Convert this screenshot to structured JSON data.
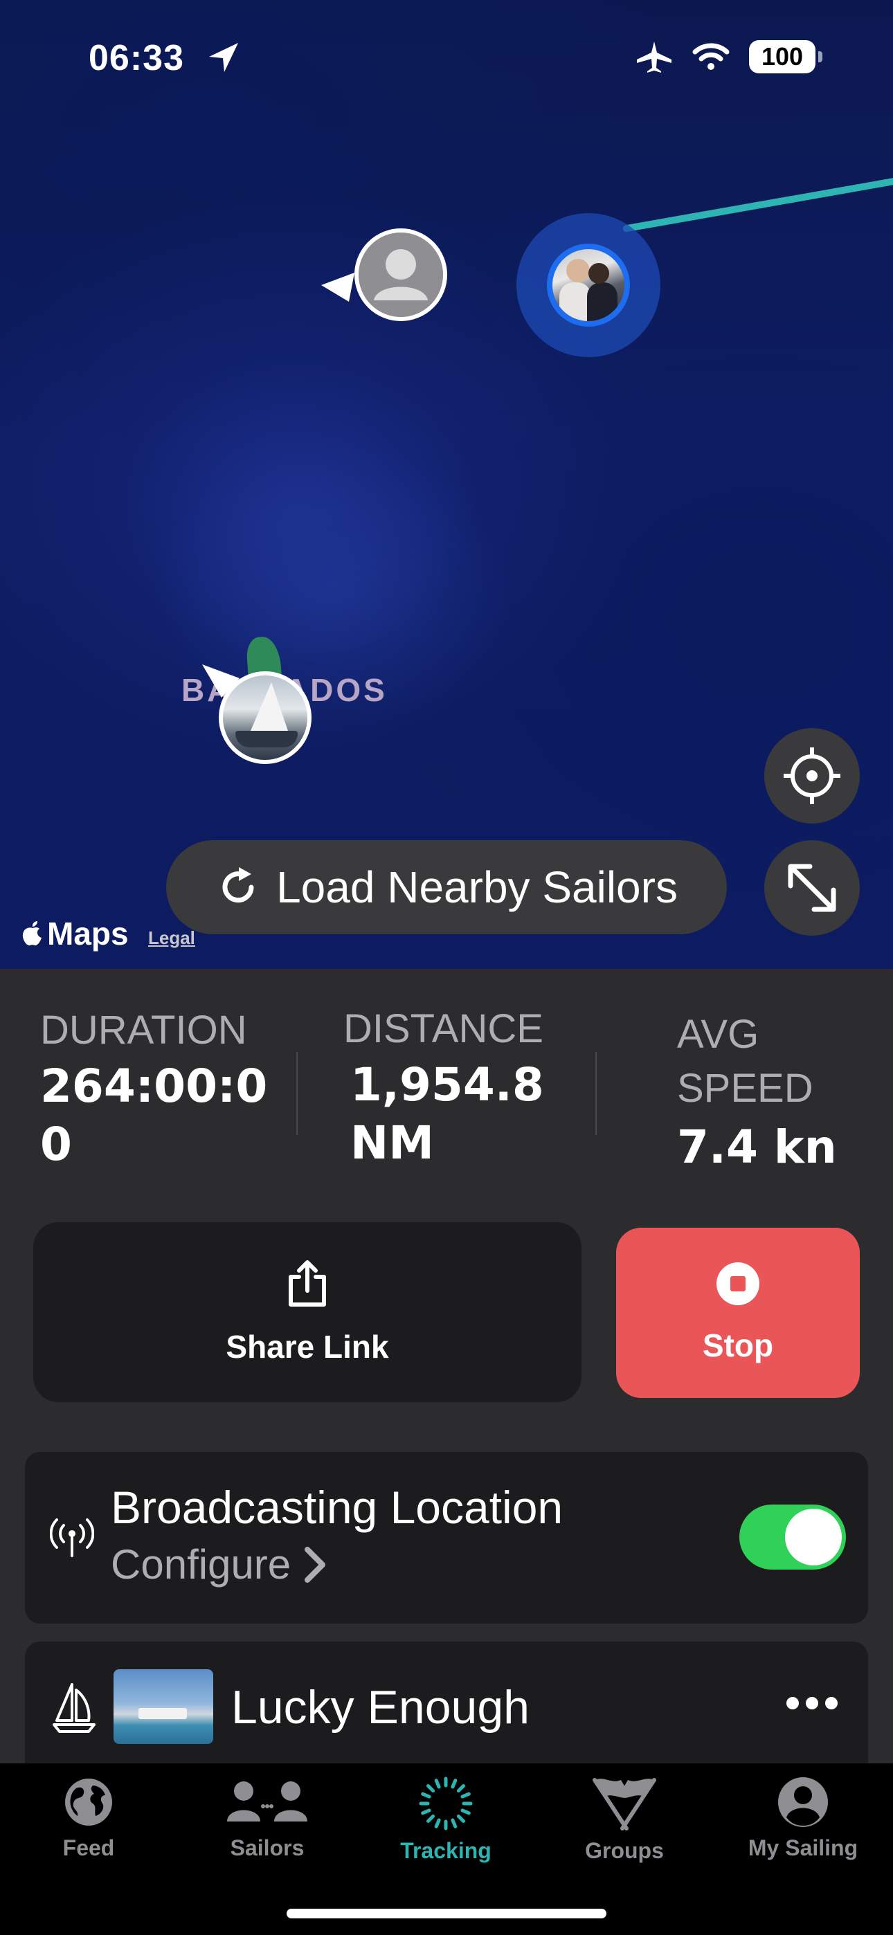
{
  "status_bar": {
    "time": "06:33",
    "battery": "100",
    "icons": [
      "location-arrow-icon",
      "airplane-icon",
      "wifi-icon",
      "battery-icon"
    ]
  },
  "map": {
    "island_label": "BARBADOS",
    "load_nearby_label": "Load Nearby Sailors",
    "maps_brand": "Maps",
    "legal_label": "Legal",
    "track_color": "#2eb5b3",
    "markers": [
      "self-avatar",
      "sailor-avatar",
      "boat-avatar"
    ]
  },
  "stats": {
    "duration_label": "DURATION",
    "duration_value_line1": "264:00:0",
    "duration_value_line2": "0",
    "distance_label": "DISTANCE",
    "distance_value_line1": "1,954.8",
    "distance_value_line2": "NM",
    "avg_speed_label_line1": "AVG",
    "avg_speed_label_line2": "SPEED",
    "avg_speed_value": "7.4 kn"
  },
  "actions": {
    "share_label": "Share Link",
    "stop_label": "Stop",
    "stop_color": "#ea5557"
  },
  "broadcast": {
    "title": "Broadcasting Location",
    "configure_label": "Configure",
    "enabled": true,
    "toggle_color": "#30d158"
  },
  "boat": {
    "name": "Lucky Enough"
  },
  "tabs": [
    {
      "label": "Feed",
      "icon": "globe-icon",
      "active": false
    },
    {
      "label": "Sailors",
      "icon": "people-icon",
      "active": false
    },
    {
      "label": "Tracking",
      "icon": "tracking-ring-icon",
      "active": true
    },
    {
      "label": "Groups",
      "icon": "crossed-flags-icon",
      "active": false
    },
    {
      "label": "My Sailing",
      "icon": "person-circle-icon",
      "active": false
    }
  ],
  "accent_color": "#2cb5b2"
}
